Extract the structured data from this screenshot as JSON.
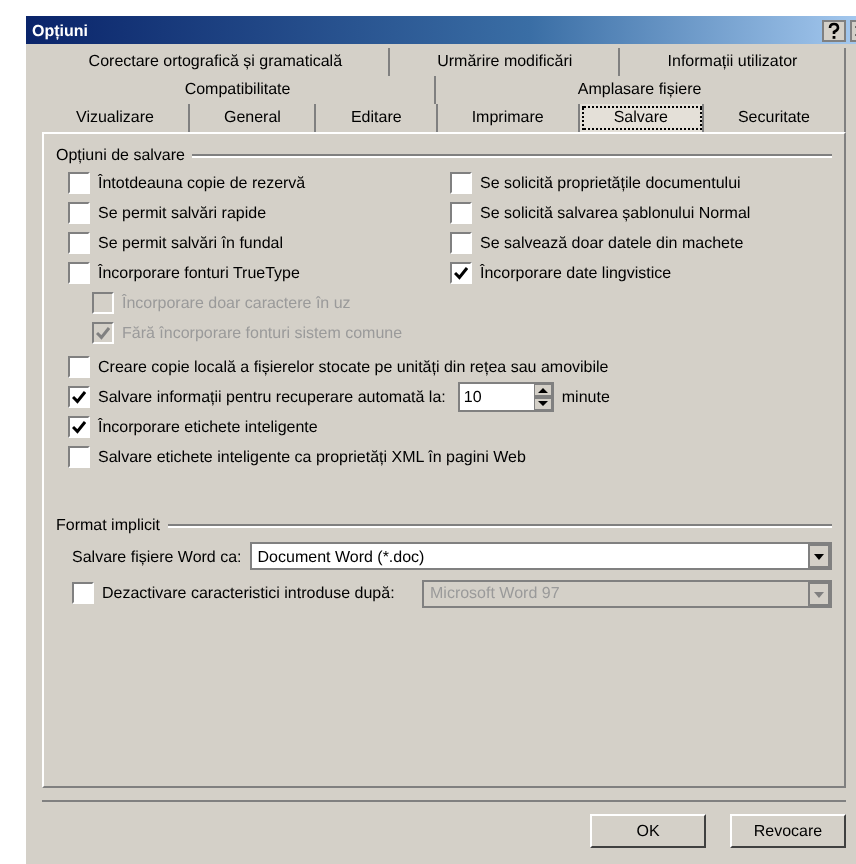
{
  "window": {
    "title": "Opțiuni"
  },
  "tab_rows": [
    [
      {
        "label": "Corectare ortografică și gramaticală",
        "selected": false
      },
      {
        "label": "Urmărire modificări",
        "selected": false
      },
      {
        "label": "Informații utilizator",
        "selected": false
      }
    ],
    [
      {
        "label": "Compatibilitate",
        "selected": false
      },
      {
        "label": "Amplasare fișiere",
        "selected": false
      }
    ],
    [
      {
        "label": "Vizualizare",
        "selected": false
      },
      {
        "label": "General",
        "selected": false
      },
      {
        "label": "Editare",
        "selected": false
      },
      {
        "label": "Imprimare",
        "selected": false
      },
      {
        "label": "Salvare",
        "selected": true
      },
      {
        "label": "Securitate",
        "selected": false
      }
    ]
  ],
  "save_options": {
    "title": "Opțiuni de salvare",
    "left": [
      {
        "label": "Întotdeauna copie de rezervă",
        "checked": false,
        "disabled": false
      },
      {
        "label": "Se permit salvări rapide",
        "checked": false,
        "disabled": false
      },
      {
        "label": "Se permit salvări în fundal",
        "checked": false,
        "disabled": false
      },
      {
        "label": "Încorporare fonturi TrueType",
        "checked": false,
        "disabled": false,
        "children": [
          {
            "label": "Încorporare doar caractere în uz",
            "checked": false,
            "disabled": true
          },
          {
            "label": "Fără încorporare fonturi sistem comune",
            "checked": true,
            "disabled": true
          }
        ]
      }
    ],
    "right": [
      {
        "label": "Se solicită proprietățile documentului",
        "checked": false,
        "disabled": false
      },
      {
        "label": "Se solicită salvarea șablonului Normal",
        "checked": false,
        "disabled": false
      },
      {
        "label": "Se salvează doar datele din machete",
        "checked": false,
        "disabled": false
      },
      {
        "label": "Încorporare date lingvistice",
        "checked": true,
        "disabled": false
      }
    ],
    "full": [
      {
        "kind": "checkbox",
        "label": "Creare copie locală a fișierelor stocate pe unități din rețea sau amovibile",
        "checked": false,
        "disabled": false
      },
      {
        "kind": "spin",
        "label": "Salvare informații pentru recuperare automată la:",
        "checked": true,
        "disabled": false,
        "value": "10",
        "unit": "minute"
      },
      {
        "kind": "checkbox",
        "label": "Încorporare etichete inteligente",
        "checked": true,
        "disabled": false
      },
      {
        "kind": "checkbox",
        "label": "Salvare etichete inteligente ca proprietăți XML în pagini Web",
        "checked": false,
        "disabled": false
      }
    ]
  },
  "default_format": {
    "title": "Format implicit",
    "save_as": {
      "label": "Salvare fișiere Word ca:",
      "value": "Document Word (*.doc)"
    },
    "disable_features": {
      "label": "Dezactivare caracteristici introduse după:",
      "checked": false,
      "value": "Microsoft Word 97",
      "disabled": true
    }
  },
  "buttons": [
    "OK",
    "Revocare"
  ]
}
